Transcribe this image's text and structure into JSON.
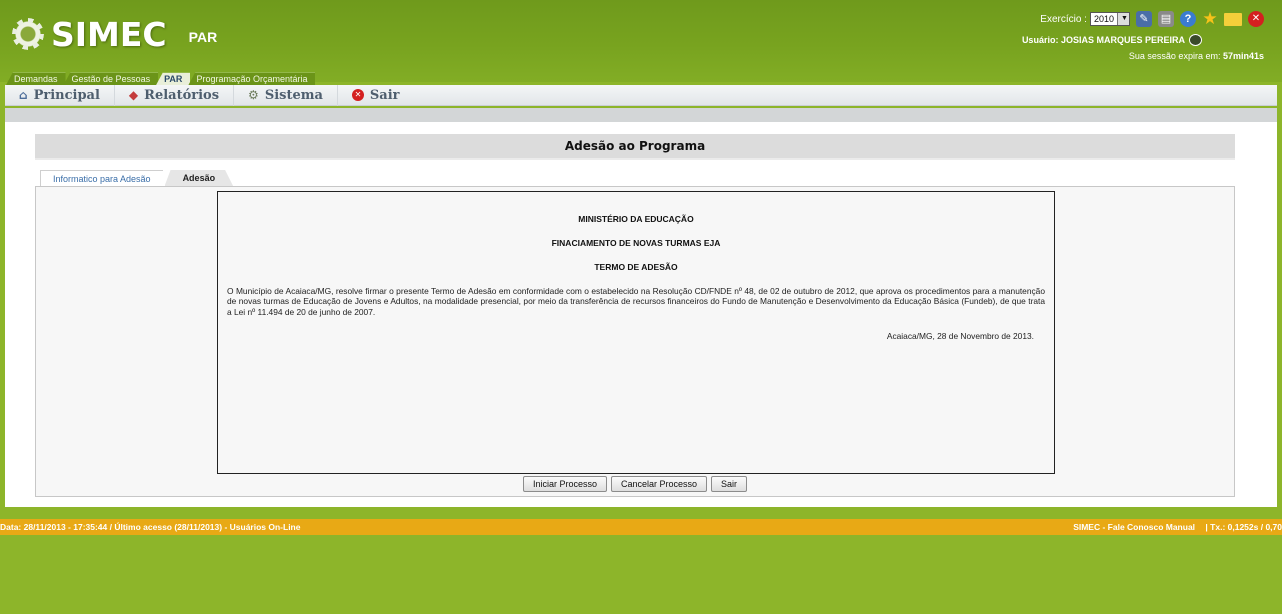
{
  "header": {
    "logo_text": "SIMEC",
    "module_name": "PAR",
    "exercicio_label": "Exercício :",
    "exercicio_value": "2010",
    "usuario_label": "Usuário:",
    "usuario_name": "JOSIAS MARQUES PEREIRA",
    "session_prefix": "Sua sessão expira em:",
    "session_time": "57min41s",
    "icons": [
      "edit-icon",
      "print-icon",
      "help-icon",
      "star-icon",
      "mail-icon",
      "close-icon"
    ]
  },
  "module_tabs": [
    "Demandas",
    "Gestão de Pessoas",
    "PAR",
    "Programação Orçamentária"
  ],
  "menu": {
    "principal": "Principal",
    "relatorios": "Relatórios",
    "sistema": "Sistema",
    "sair": "Sair"
  },
  "page": {
    "title": "Adesão ao Programa",
    "tabs": [
      "Informatico para Adesão",
      "Adesão"
    ]
  },
  "document": {
    "heading1": "MINISTÉRIO DA EDUCAÇÃO",
    "heading2": "FINACIAMENTO DE NOVAS TURMAS EJA",
    "heading3": "TERMO DE ADESÃO",
    "body": "O Município de Acaiaca/MG, resolve firmar o presente Termo de Adesão em conformidade com o estabelecido na Resolução CD/FNDE nº 48, de 02 de outubro de 2012, que aprova os procedimentos para a manutenção de novas turmas de Educação de Jovens e Adultos, na modalidade presencial, por meio da transferência de recursos financeiros do Fundo de Manutenção e Desenvolvimento da Educação Básica (Fundeb), de que trata a Lei nº 11.494 de 20 de junho de 2007.",
    "date": "Acaiaca/MG, 28 de Novembro de 2013."
  },
  "buttons": {
    "iniciar": "Iniciar Processo",
    "cancelar": "Cancelar Processo",
    "sair": "Sair"
  },
  "footer": {
    "left": "Data: 28/11/2013 - 17:35:44 / Último acesso (28/11/2013) - Usuários On-Line",
    "right_links": "SIMEC - Fale Conosco Manual",
    "right_stats": "| Tx.: 0,1252s / 0,70"
  }
}
